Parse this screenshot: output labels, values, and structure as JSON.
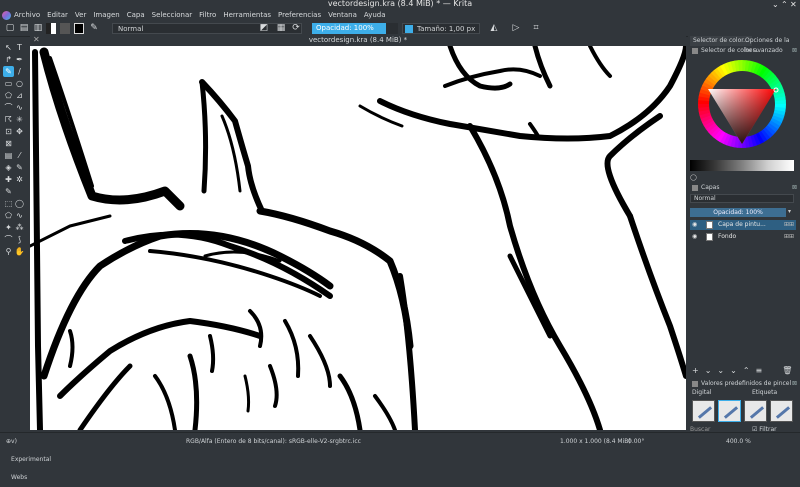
{
  "window": {
    "title": "vectordesign.kra (8.4 MiB) * — Krita"
  },
  "menu": [
    "Archivo",
    "Editar",
    "Ver",
    "Imagen",
    "Capa",
    "Seleccionar",
    "Filtro",
    "Herramientas",
    "Preferencias",
    "Ventana",
    "Ayuda"
  ],
  "toolbar": {
    "blend_mode": "Normal",
    "opacity": "Opacidad: 100%",
    "size": "Tamaño: 1,00 px"
  },
  "document_tab": {
    "title": "vectordesign.kra (8.4 MiB) *"
  },
  "docker_tabs": [
    "Opciones de la her...",
    "Selector de color..."
  ],
  "color_selector": {
    "title": "Selector de color avanzado"
  },
  "layers": {
    "title": "Capas",
    "blend_mode": "Normal",
    "opacity": "Opacidad: 100%",
    "items": [
      {
        "name": "Capa de pintu..."
      },
      {
        "name": "Fondo"
      }
    ]
  },
  "brush_presets": {
    "title": "Valores predefinidos de pincel",
    "category": "Digital",
    "tag": "Etiqueta",
    "filter": "Filtrar etiqueta",
    "search": "Buscar"
  },
  "status": {
    "brush": "v) Experimental Webs",
    "color": "RGB/Alfa (Entero de 8 bits/canal): sRGB-elle-V2-srgbtrc.icc",
    "dims": "1.000 x 1.000 (8.4 MiB)",
    "rotation": "0.00°",
    "zoom": "400.0 %"
  },
  "colors": {
    "accent": "#3daee9",
    "panel": "#31363b"
  }
}
